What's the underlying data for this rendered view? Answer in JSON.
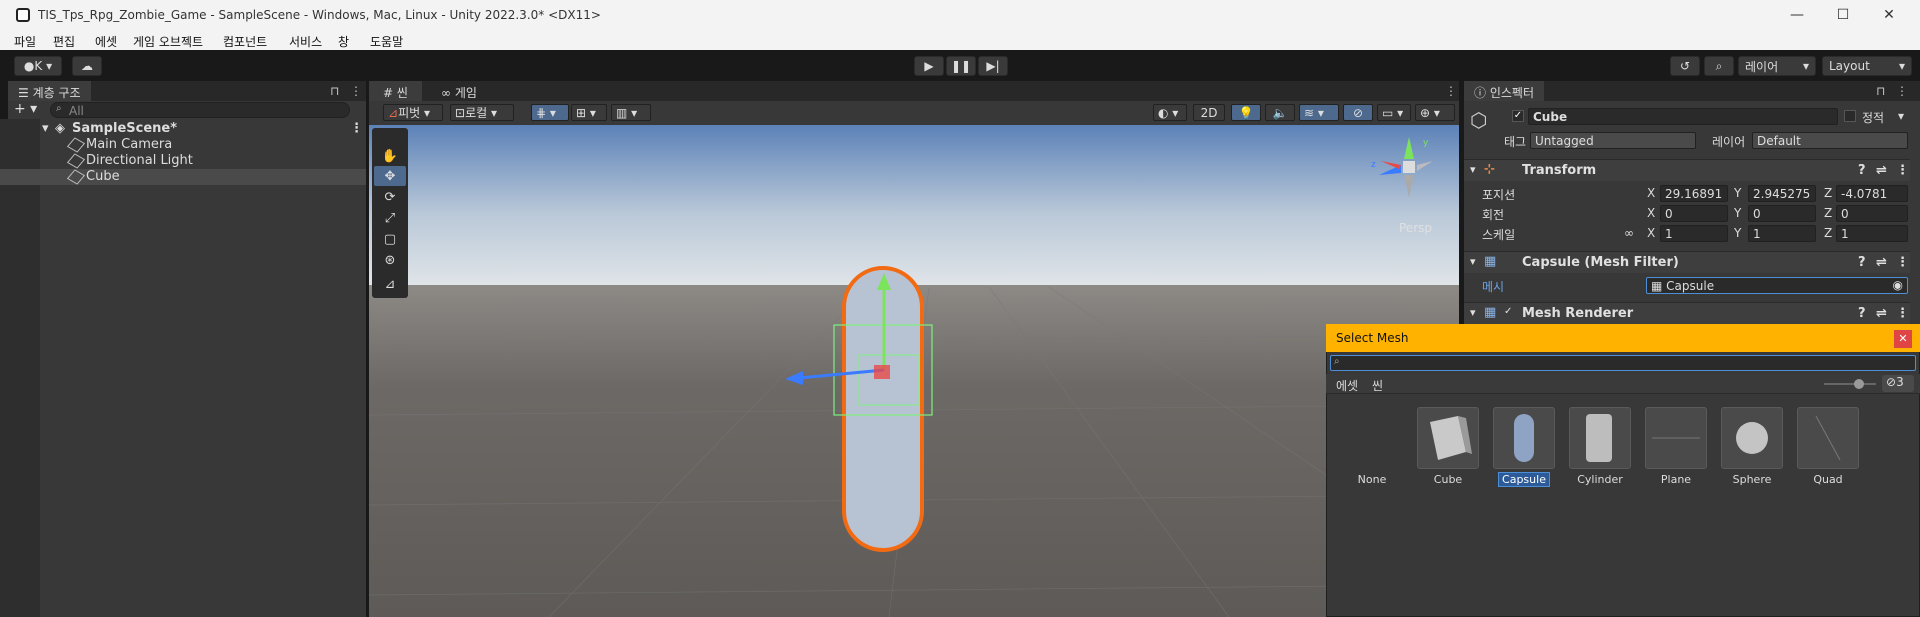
{
  "window": {
    "title": "TIS_Tps_Rpg_Zombie_Game - SampleScene - Windows, Mac, Linux - Unity 2022.3.0* <DX11>",
    "minimize": "—",
    "maximize": "☐",
    "close": "✕"
  },
  "menu": [
    "파일",
    "편집",
    "에셋",
    "게임 오브젝트",
    "컴포넌트",
    "서비스",
    "창",
    "도움말"
  ],
  "toolbar": {
    "account": "K",
    "layers": "레이어",
    "layout": "Layout"
  },
  "hierarchy": {
    "tab": "계층 구조",
    "search_placeholder": "All",
    "scene": "SampleScene*",
    "items": [
      "Main Camera",
      "Directional Light",
      "Cube"
    ]
  },
  "scene_view": {
    "tabs": [
      "씬",
      "게임"
    ],
    "pivot": "피벗",
    "local": "로컬",
    "mode_2d": "2D",
    "persp": "Persp"
  },
  "inspector": {
    "tab": "인스펙터",
    "object_name": "Cube",
    "static_label": "정적",
    "tag_label": "태그",
    "tag_value": "Untagged",
    "layer_label": "레이어",
    "layer_value": "Default",
    "transform": {
      "title": "Transform",
      "position_label": "포지션",
      "rotation_label": "회전",
      "scale_label": "스케일",
      "position": [
        "29.16891",
        "2.945275",
        "-4.0781"
      ],
      "rotation": [
        "0",
        "0",
        "0"
      ],
      "scale": [
        "1",
        "1",
        "1"
      ]
    },
    "mesh_filter": {
      "title": "Capsule (Mesh Filter)",
      "mesh_label": "메시",
      "mesh_value": "Capsule"
    },
    "mesh_renderer": {
      "title": "Mesh Renderer"
    }
  },
  "select_mesh": {
    "title": "Select Mesh",
    "tabs": [
      "에셋",
      "씬"
    ],
    "hidden_count": "3",
    "items": [
      "None",
      "Cube",
      "Capsule",
      "Cylinder",
      "Plane",
      "Sphere",
      "Quad"
    ],
    "selected": "Capsule"
  },
  "colors": {
    "accent": "#4d8fd6",
    "dialog_header": "#ffb300",
    "selection_orange": "#f26a12"
  }
}
